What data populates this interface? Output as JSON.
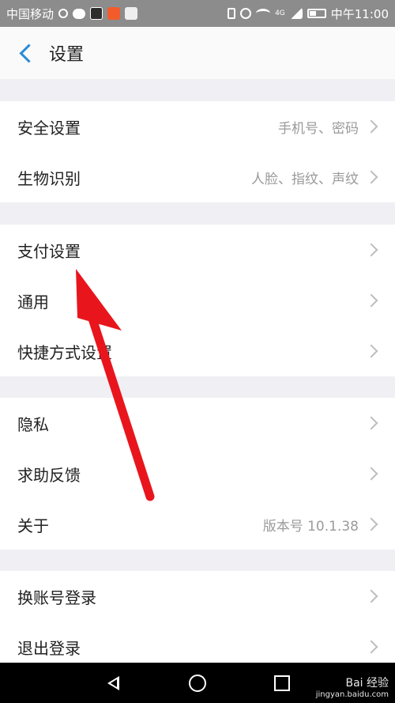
{
  "status_bar": {
    "carrier": "中国移动",
    "network": "4G",
    "time": "中午11:00"
  },
  "header": {
    "title": "设置"
  },
  "groups": [
    {
      "rows": [
        {
          "label": "安全设置",
          "value": "手机号、密码"
        },
        {
          "label": "生物识别",
          "value": "人脸、指纹、声纹"
        }
      ]
    },
    {
      "rows": [
        {
          "label": "支付设置",
          "value": ""
        },
        {
          "label": "通用",
          "value": ""
        },
        {
          "label": "快捷方式设置",
          "value": ""
        }
      ]
    },
    {
      "rows": [
        {
          "label": "隐私",
          "value": ""
        },
        {
          "label": "求助反馈",
          "value": ""
        },
        {
          "label": "关于",
          "value": "版本号 10.1.38"
        }
      ]
    },
    {
      "rows": [
        {
          "label": "换账号登录",
          "value": ""
        },
        {
          "label": "退出登录",
          "value": ""
        }
      ]
    }
  ],
  "watermark": {
    "brand": "Bai 经验",
    "url": "jingyan.baidu.com"
  },
  "annotation": {
    "arrow_color": "#e8161c"
  }
}
